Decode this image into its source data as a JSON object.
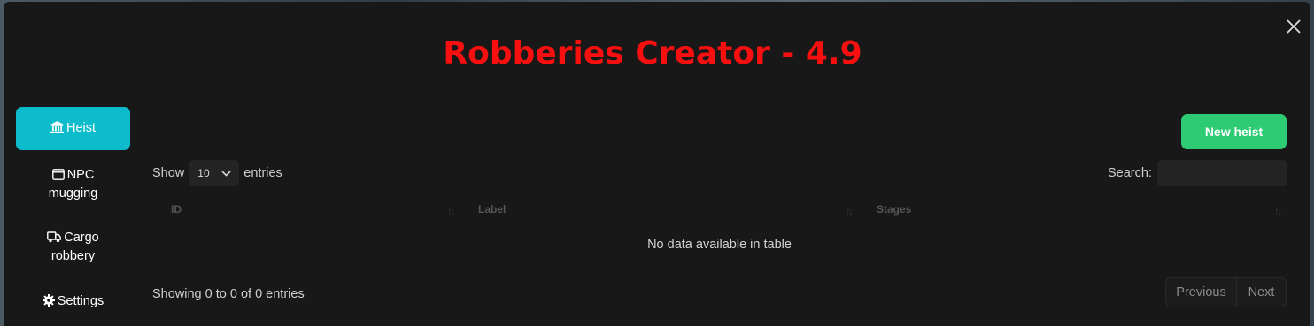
{
  "title": "Robberies Creator - 4.9",
  "colors": {
    "title": "#f80f0f",
    "active_tab": "#0cbccd",
    "new_button": "#2dcc74",
    "background": "#181818"
  },
  "sidebar": {
    "items": [
      {
        "label": "Heist",
        "icon": "bank-icon",
        "active": true
      },
      {
        "label": "NPC mugging",
        "icon": "window-icon",
        "active": false
      },
      {
        "label": "Cargo robbery",
        "icon": "truck-icon",
        "active": false
      },
      {
        "label": "Settings",
        "icon": "gear-icon",
        "active": false
      }
    ]
  },
  "toolbar": {
    "new_label": "New heist"
  },
  "table_controls": {
    "show_label": "Show",
    "page_length": "10",
    "entries_label": "entries",
    "search_label": "Search:",
    "search_value": ""
  },
  "table": {
    "columns": [
      "ID",
      "Label",
      "Stages"
    ],
    "rows": [],
    "empty_text": "No data available in table"
  },
  "footer": {
    "info": "Showing 0 to 0 of 0 entries",
    "previous_label": "Previous",
    "next_label": "Next"
  }
}
